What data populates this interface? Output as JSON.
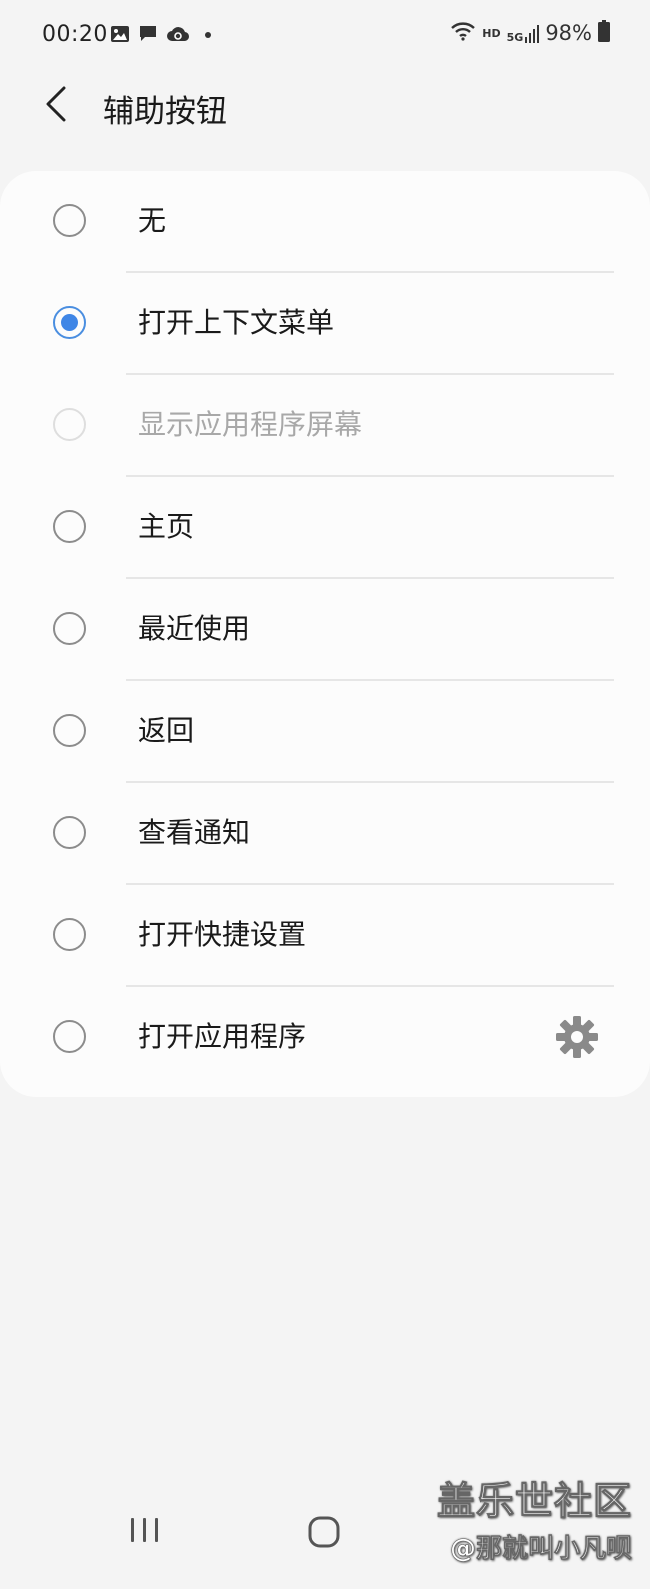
{
  "status_bar": {
    "time": "00:20",
    "network_hd": "HD",
    "network_5g": "5G",
    "battery": "98%",
    "icons": [
      "image-icon",
      "message-icon",
      "cloud-sync-icon",
      "dot-icon",
      "wifi-icon",
      "signal-icon",
      "battery-icon"
    ]
  },
  "header": {
    "title": "辅助按钮",
    "back_icon": "chevron-left-icon"
  },
  "options": [
    {
      "label": "无",
      "state": "unchecked"
    },
    {
      "label": "打开上下文菜单",
      "state": "checked"
    },
    {
      "label": "显示应用程序屏幕",
      "state": "disabled"
    },
    {
      "label": "主页",
      "state": "unchecked"
    },
    {
      "label": "最近使用",
      "state": "unchecked"
    },
    {
      "label": "返回",
      "state": "unchecked"
    },
    {
      "label": "查看通知",
      "state": "unchecked"
    },
    {
      "label": "打开快捷设置",
      "state": "unchecked"
    },
    {
      "label": "打开应用程序",
      "state": "unchecked",
      "icon": "gear-icon"
    }
  ],
  "colors": {
    "accent": "#3f86e6",
    "background": "#f4f4f4",
    "card": "#fcfcfc"
  },
  "watermark": {
    "title": "盖乐世社区",
    "user": "@那就叫小凡呗"
  },
  "nav_bar": {
    "icons": [
      "recents-icon",
      "home-icon"
    ]
  }
}
